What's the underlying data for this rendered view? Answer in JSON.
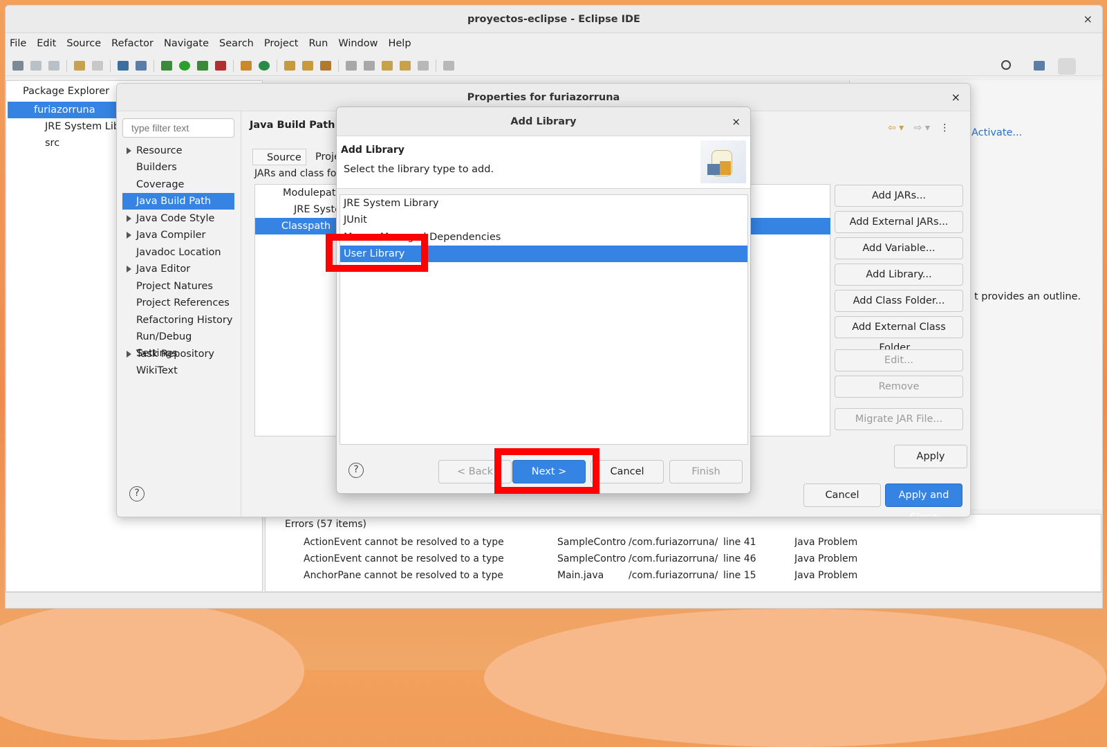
{
  "window": {
    "title": "proyectos-eclipse - Eclipse IDE",
    "close": "×"
  },
  "menu": [
    "File",
    "Edit",
    "Source",
    "Refactor",
    "Navigate",
    "Search",
    "Project",
    "Run",
    "Window",
    "Help"
  ],
  "package_explorer": {
    "tab": "Package Explorer",
    "items": [
      "furiazorruna",
      "JRE System Libra",
      "src"
    ]
  },
  "problems": {
    "group": "Errors (57 items)",
    "rows": [
      [
        "ActionEvent cannot be resolved to a type",
        "SampleControl",
        "/com.furiazorruna/s",
        "line 41",
        "Java Problem"
      ],
      [
        "ActionEvent cannot be resolved to a type",
        "SampleControl",
        "/com.furiazorruna/s",
        "line 46",
        "Java Problem"
      ],
      [
        "AnchorPane cannot be resolved to a type",
        "Main.java",
        "/com.furiazorruna/s",
        "line 15",
        "Java Problem"
      ]
    ]
  },
  "right_pane": {
    "activate": "Activate...",
    "outline": "t provides an outline."
  },
  "properties": {
    "title": "Properties for furiazorruna",
    "filter_placeholder": "type filter text",
    "nav": [
      "Resource",
      "Builders",
      "Coverage",
      "Java Build Path",
      "Java Code Style",
      "Java Compiler",
      "Javadoc Location",
      "Java Editor",
      "Project Natures",
      "Project References",
      "Refactoring History",
      "Run/Debug Settings",
      "Task Repository",
      "WikiText"
    ],
    "pane_title": "Java Build Path",
    "tabs": [
      "Source",
      "Proje"
    ],
    "jars_label": "JARs and class fold",
    "tree": [
      "Modulepath",
      "JRE Syste",
      "Classpath"
    ],
    "side_buttons": [
      "Add JARs...",
      "Add External JARs...",
      "Add Variable...",
      "Add Library...",
      "Add Class Folder...",
      "Add External Class Folder...",
      "Edit...",
      "Remove",
      "Migrate JAR File..."
    ],
    "apply": "Apply",
    "cancel": "Cancel",
    "apply_close": "Apply and Close"
  },
  "add_library": {
    "title": "Add Library",
    "header": "Add Library",
    "subheader": "Select the library type to add.",
    "items": [
      "JRE System Library",
      "JUnit",
      "Maven Managed Dependencies",
      "User Library"
    ],
    "selected": "User Library",
    "buttons": {
      "back": "< Back",
      "next": "Next >",
      "cancel": "Cancel",
      "finish": "Finish"
    }
  },
  "colors": {
    "accent": "#3584e4",
    "highlight": "#ff0000"
  }
}
